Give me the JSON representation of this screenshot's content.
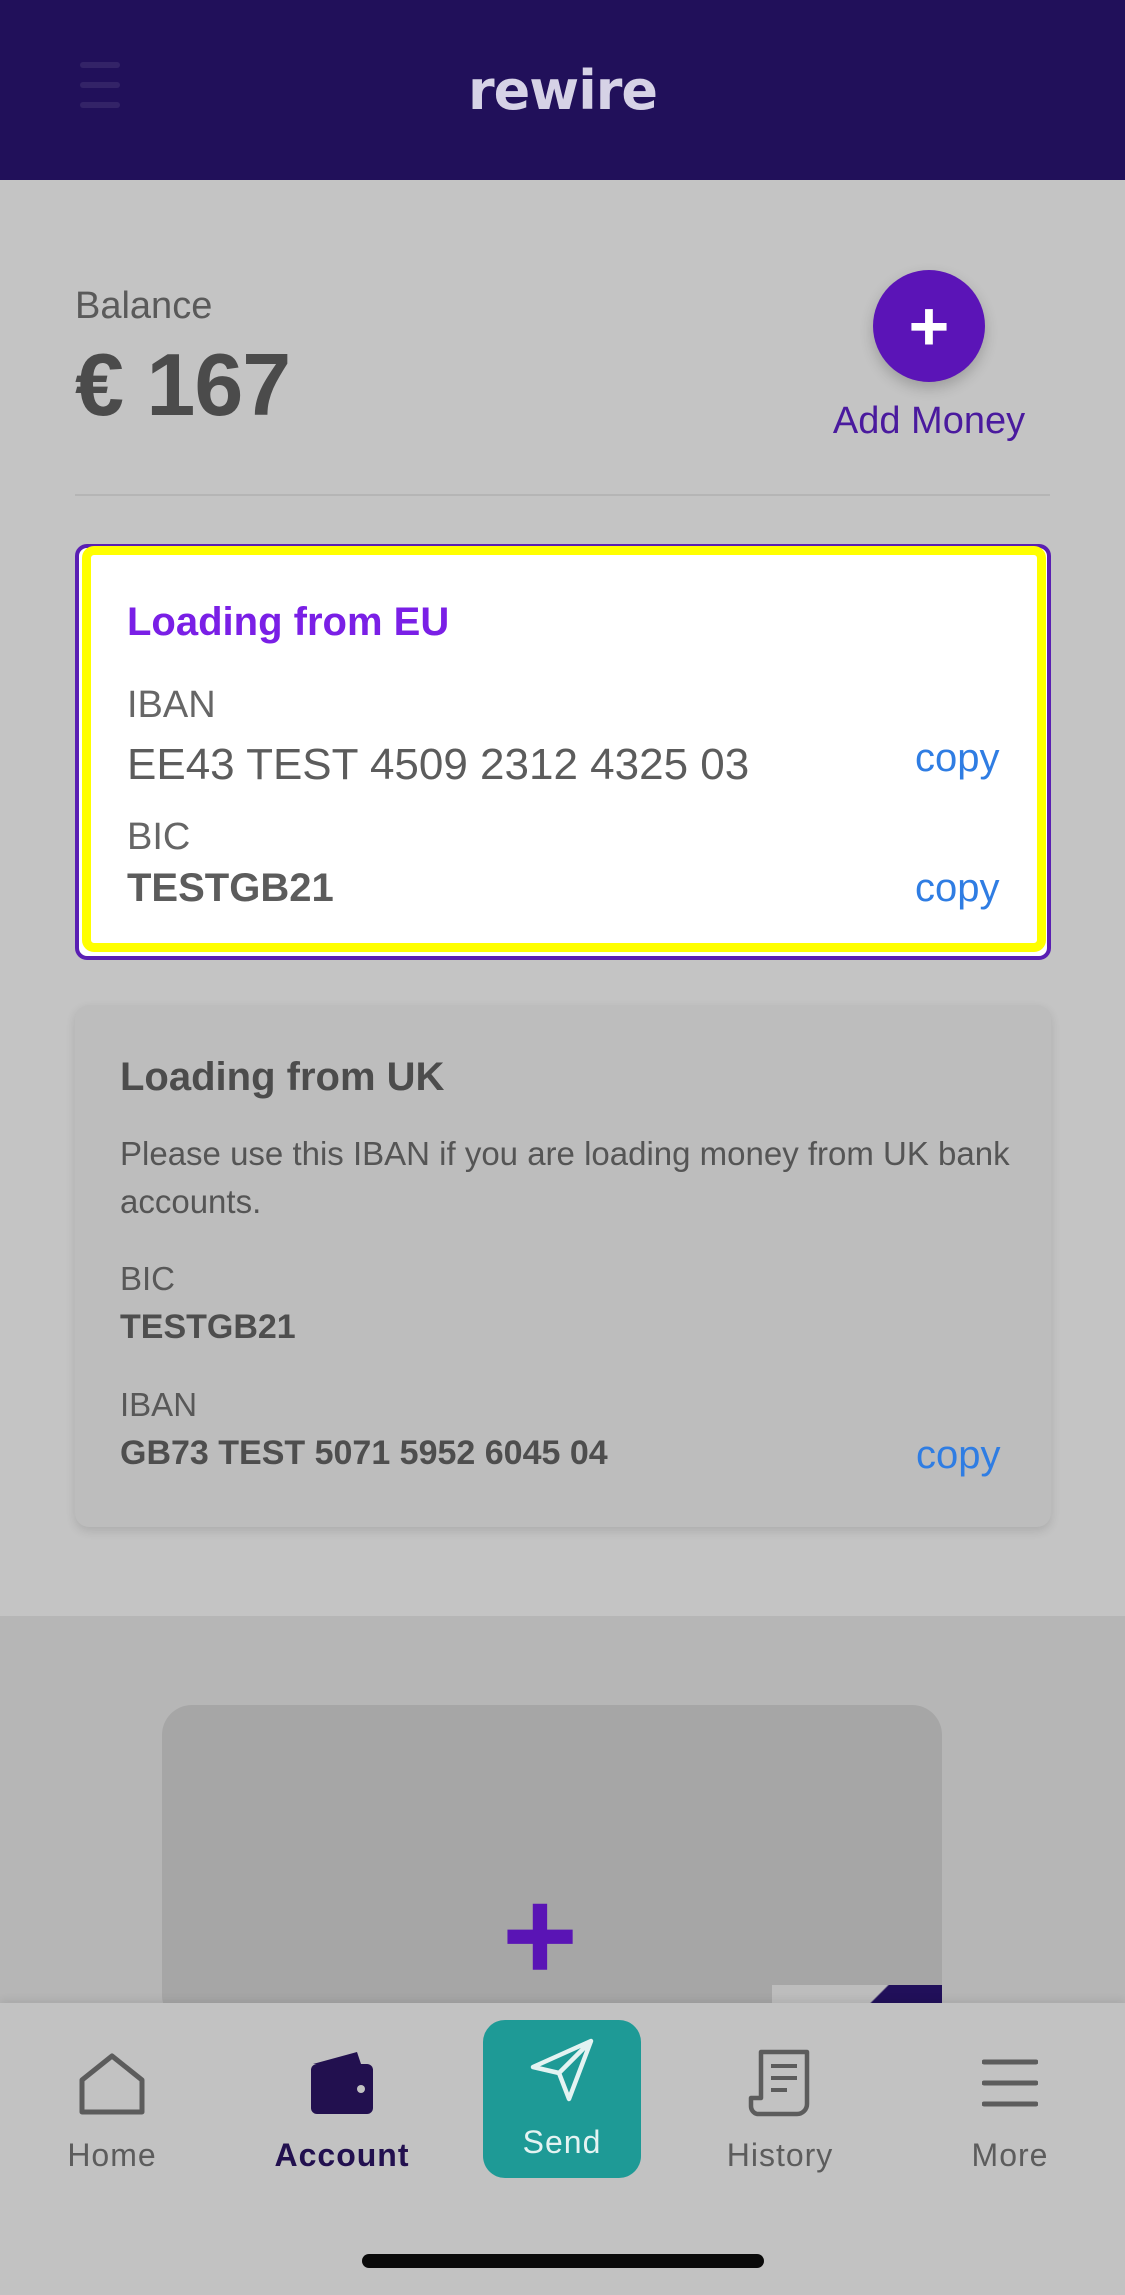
{
  "header": {
    "logo": "rewire"
  },
  "balance": {
    "label": "Balance",
    "amount": "€ 167"
  },
  "add_money": {
    "icon": "plus-icon",
    "label": "Add Money"
  },
  "eu_card": {
    "title": "Loading from EU",
    "iban_label": "IBAN",
    "iban_value": "EE43 TEST 4509 2312 4325 03",
    "bic_label": "BIC",
    "bic_value": "TESTGB21",
    "copy_label": "copy"
  },
  "uk_card": {
    "title": "Loading from UK",
    "description": "Please use this IBAN if you are loading money from UK bank accounts.",
    "bic_label": "BIC",
    "bic_value": "TESTGB21",
    "iban_label": "IBAN",
    "iban_value": "GB73 TEST 5071 5952 6045 04",
    "copy_label": "copy"
  },
  "tabs": [
    {
      "label": "Home",
      "icon": "home-icon"
    },
    {
      "label": "Account",
      "icon": "wallet-icon",
      "active": true
    },
    {
      "label": "Send",
      "icon": "paper-plane-icon"
    },
    {
      "label": "History",
      "icon": "receipt-icon"
    },
    {
      "label": "More",
      "icon": "menu-icon"
    }
  ],
  "colors": {
    "header": "#21105a",
    "accent": "#5b14b7",
    "eu_title": "#7a1fe6",
    "copy": "#2f7de3",
    "send": "#1e9a96",
    "highlight": "#ffff00"
  }
}
